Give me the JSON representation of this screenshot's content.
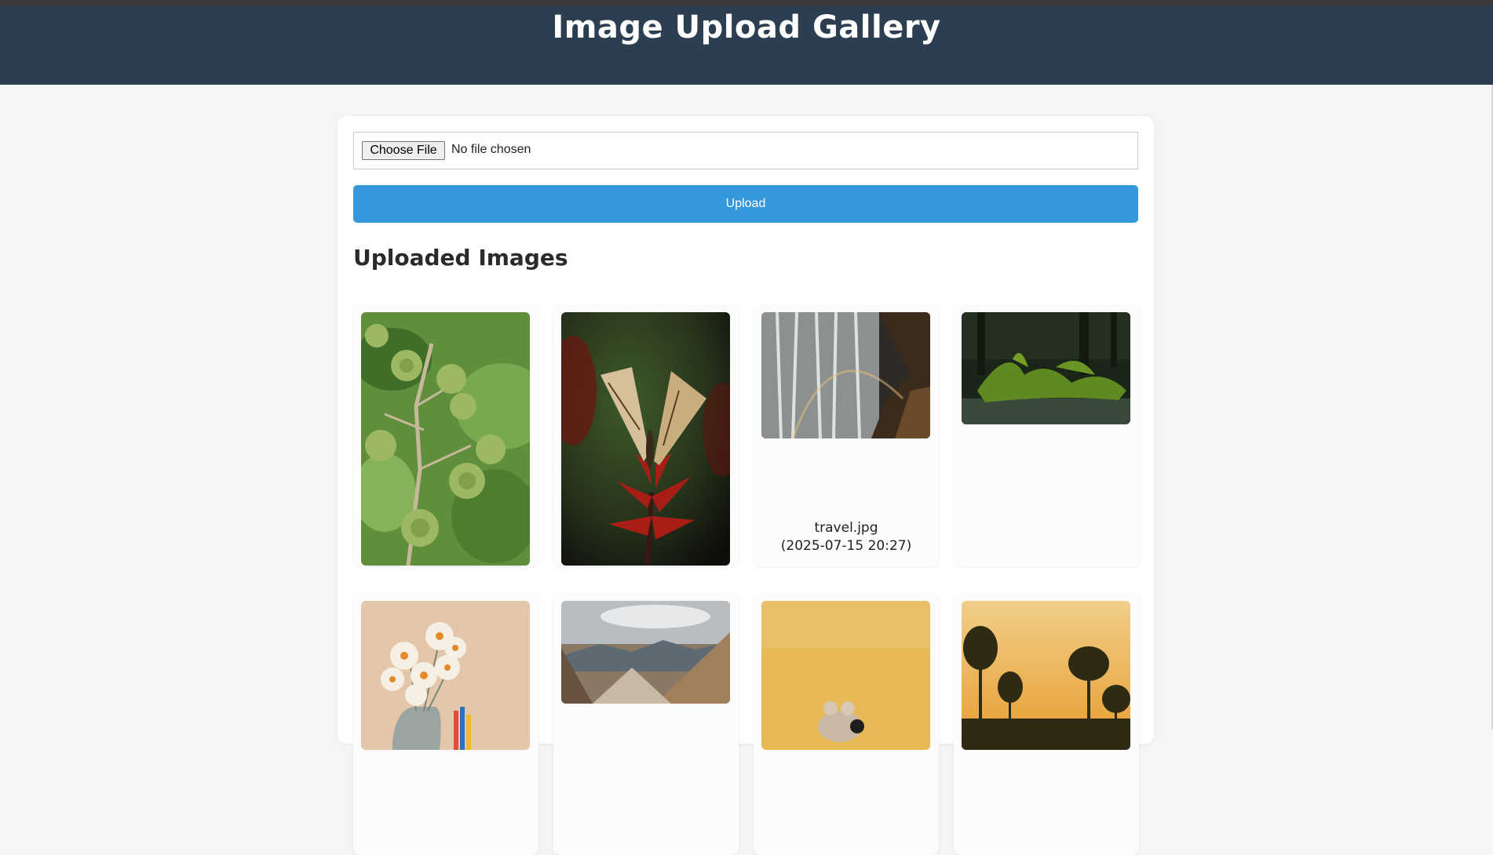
{
  "header": {
    "title": "Image Upload Gallery"
  },
  "uploader": {
    "choose_label": "Choose File",
    "file_status": "No file chosen",
    "upload_label": "Upload"
  },
  "gallery": {
    "title": "Uploaded Images",
    "items": [
      {
        "subject": "green berries on branch"
      },
      {
        "subject": "butterfly on red flower"
      },
      {
        "subject": "waterfall with rainbow",
        "name": "travel.jpg",
        "date": "(2025-07-15 20:27)"
      },
      {
        "subject": "mossy log in forest"
      },
      {
        "subject": "white flowers in vase"
      },
      {
        "subject": "mountain valley"
      },
      {
        "subject": "toy on yellow background"
      },
      {
        "subject": "pine trees at sunset"
      }
    ]
  },
  "colors": {
    "header_bg": "#2d3e50",
    "accent": "#3498db",
    "page_bg": "#f4f5f7"
  }
}
